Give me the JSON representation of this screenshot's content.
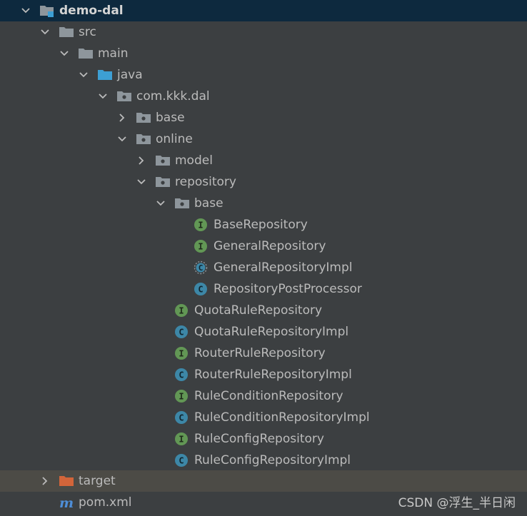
{
  "tree": {
    "root": {
      "label": "demo-dal"
    },
    "src": {
      "label": "src"
    },
    "main": {
      "label": "main"
    },
    "java": {
      "label": "java"
    },
    "pkg": {
      "label": "com.kkk.dal"
    },
    "base": {
      "label": "base"
    },
    "online": {
      "label": "online"
    },
    "model": {
      "label": "model"
    },
    "repository": {
      "label": "repository"
    },
    "repo_base": {
      "label": "base"
    },
    "files": [
      {
        "label": "BaseRepository",
        "kind": "interface"
      },
      {
        "label": "GeneralRepository",
        "kind": "interface"
      },
      {
        "label": "GeneralRepositoryImpl",
        "kind": "abstract-class"
      },
      {
        "label": "RepositoryPostProcessor",
        "kind": "class"
      },
      {
        "label": "QuotaRuleRepository",
        "kind": "interface"
      },
      {
        "label": "QuotaRuleRepositoryImpl",
        "kind": "class"
      },
      {
        "label": "RouterRuleRepository",
        "kind": "interface"
      },
      {
        "label": "RouterRuleRepositoryImpl",
        "kind": "class"
      },
      {
        "label": "RuleConditionRepository",
        "kind": "interface"
      },
      {
        "label": "RuleConditionRepositoryImpl",
        "kind": "class"
      },
      {
        "label": "RuleConfigRepository",
        "kind": "interface"
      },
      {
        "label": "RuleConfigRepositoryImpl",
        "kind": "class"
      }
    ],
    "target": {
      "label": "target"
    },
    "pom": {
      "label": "pom.xml"
    }
  },
  "colors": {
    "interface": "#629755",
    "class": "#3d87a7",
    "folder": "#8e969c",
    "source_folder": "#3d9fd4",
    "excluded_folder": "#d2653a",
    "maven": "#4e8ed8"
  },
  "watermark": "CSDN @浮生_半日闲"
}
